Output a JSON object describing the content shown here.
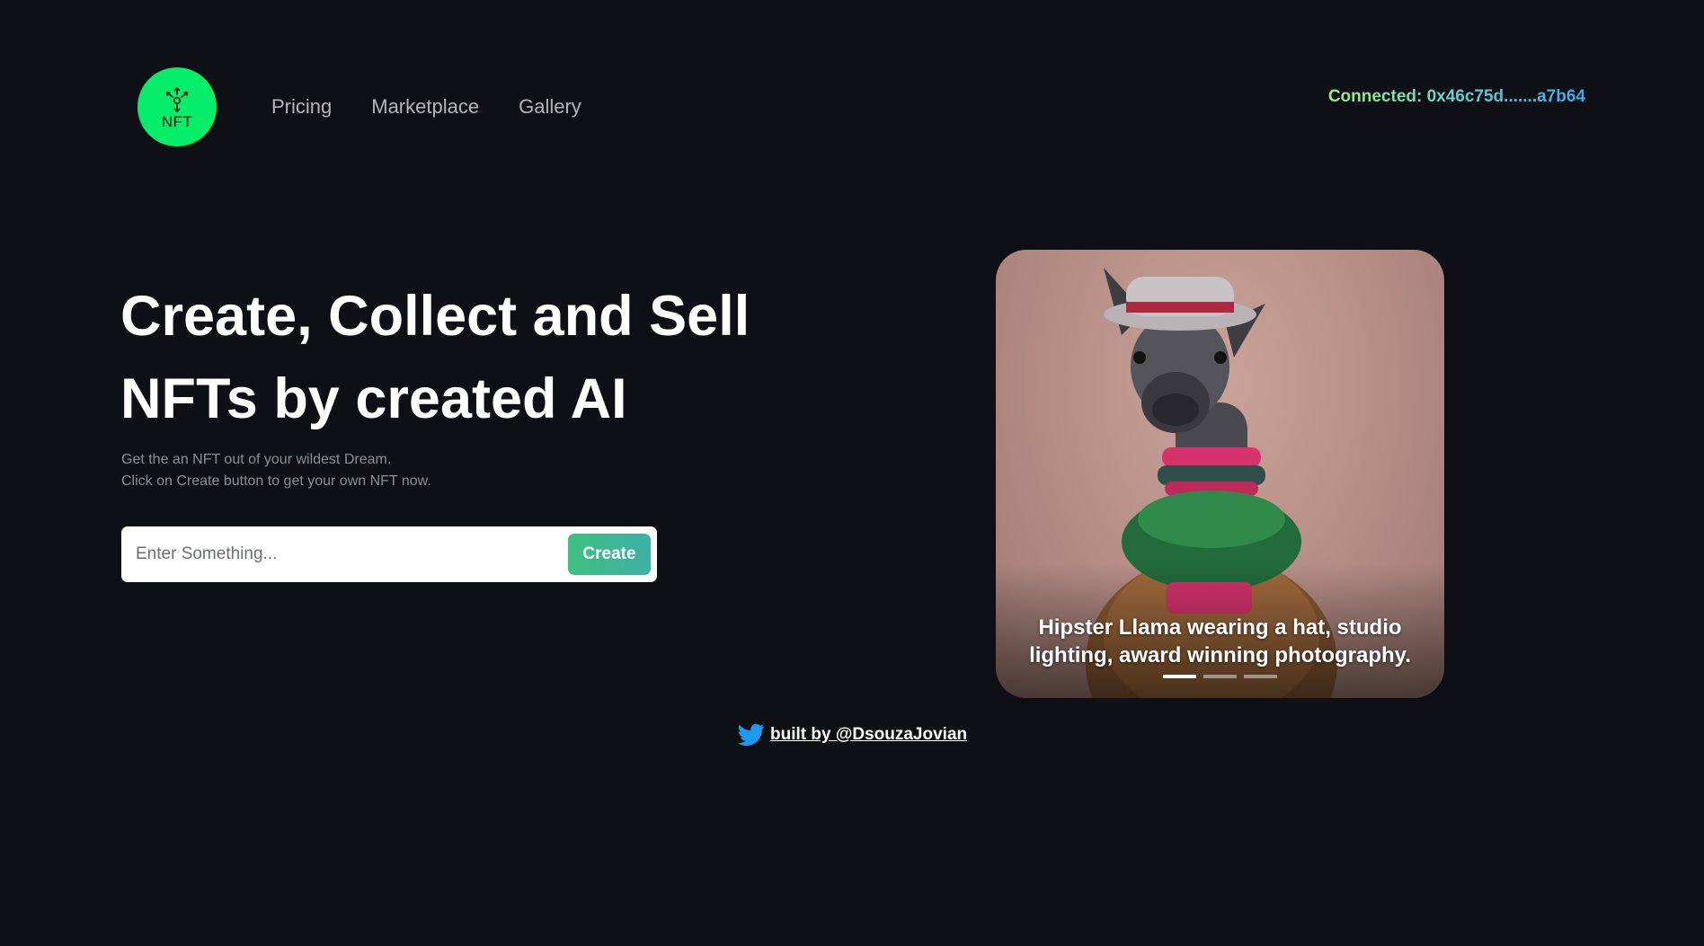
{
  "header": {
    "logo_text": "NFT",
    "nav": [
      {
        "label": "Pricing"
      },
      {
        "label": "Marketplace"
      },
      {
        "label": "Gallery"
      }
    ],
    "wallet_label": "Connected: 0x46c75d.......a7b64"
  },
  "hero": {
    "title_line1": "Create, Collect and Sell",
    "title_line2": "NFTs by created AI",
    "subtitle_line1": "Get the an NFT out of your wildest Dream.",
    "subtitle_line2": "Click on Create button to get your own NFT now.",
    "input_placeholder": "Enter Something...",
    "create_label": "Create"
  },
  "carousel": {
    "caption": "Hipster Llama wearing a hat, studio lighting, award winning photography.",
    "slide_count": 3,
    "active_index": 0
  },
  "footer": {
    "credit": "built by @DsouzaJovian",
    "icon": "twitter-icon"
  },
  "colors": {
    "background": "#0e1015",
    "logo_green": "#06ee67",
    "button_gradient_start": "#3ebf82",
    "button_gradient_end": "#3cb1a6",
    "twitter_blue": "#1d9bf0"
  }
}
